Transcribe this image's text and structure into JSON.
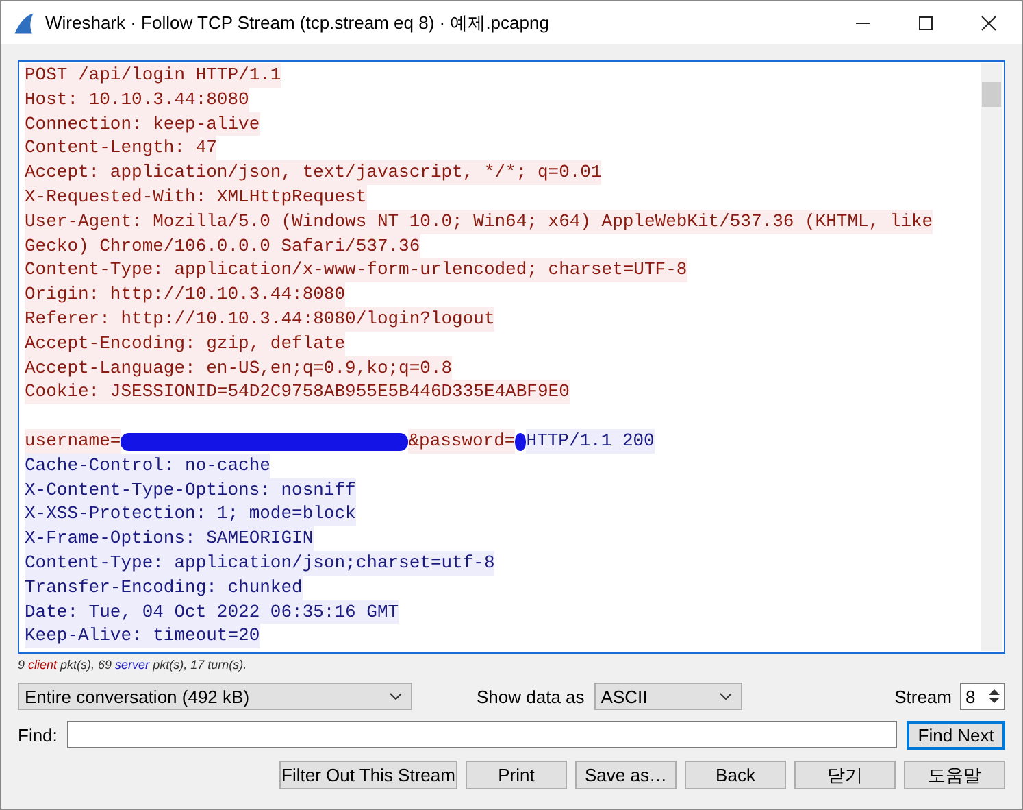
{
  "window": {
    "title": "Wireshark · Follow TCP Stream (tcp.stream eq 8) · 예제.pcapng"
  },
  "stream_lines": [
    {
      "kind": "client",
      "text": "POST /api/login HTTP/1.1"
    },
    {
      "kind": "client",
      "text": "Host: 10.10.3.44:8080"
    },
    {
      "kind": "client",
      "text": "Connection: keep-alive"
    },
    {
      "kind": "client",
      "text": "Content-Length: 47"
    },
    {
      "kind": "client",
      "text": "Accept: application/json, text/javascript, */*; q=0.01"
    },
    {
      "kind": "client",
      "text": "X-Requested-With: XMLHttpRequest"
    },
    {
      "kind": "client",
      "text": "User-Agent: Mozilla/5.0 (Windows NT 10.0; Win64; x64) AppleWebKit/537.36 (KHTML, like"
    },
    {
      "kind": "client",
      "text": "Gecko) Chrome/106.0.0.0 Safari/537.36"
    },
    {
      "kind": "client",
      "text": "Content-Type: application/x-www-form-urlencoded; charset=UTF-8"
    },
    {
      "kind": "client",
      "text": "Origin: http://10.10.3.44:8080"
    },
    {
      "kind": "client",
      "text": "Referer: http://10.10.3.44:8080/login?logout"
    },
    {
      "kind": "client",
      "text": "Accept-Encoding: gzip, deflate"
    },
    {
      "kind": "client",
      "text": "Accept-Language: en-US,en;q=0.9,ko;q=0.8"
    },
    {
      "kind": "client",
      "text": "Cookie: JSESSIONID=54D2C9758AB955E5B446D335E4ABF9E0"
    },
    {
      "kind": "blank"
    },
    {
      "kind": "mixed",
      "parts": [
        {
          "kind": "client",
          "text": "username="
        },
        {
          "kind": "redacted"
        },
        {
          "kind": "client",
          "text": "&password="
        },
        {
          "kind": "redacted"
        },
        {
          "kind": "server",
          "text": "HTTP/1.1 200"
        }
      ]
    },
    {
      "kind": "server",
      "text": "Cache-Control: no-cache"
    },
    {
      "kind": "server",
      "text": "X-Content-Type-Options: nosniff"
    },
    {
      "kind": "server",
      "text": "X-XSS-Protection: 1; mode=block"
    },
    {
      "kind": "server",
      "text": "X-Frame-Options: SAMEORIGIN"
    },
    {
      "kind": "server",
      "text": "Content-Type: application/json;charset=utf-8"
    },
    {
      "kind": "server",
      "text": "Transfer-Encoding: chunked"
    },
    {
      "kind": "server",
      "text": "Date: Tue, 04 Oct 2022 06:35:16 GMT"
    },
    {
      "kind": "server",
      "text": "Keep-Alive: timeout=20"
    }
  ],
  "stats": [
    {
      "kind": "plain",
      "text": "9 "
    },
    {
      "kind": "client",
      "text": "client"
    },
    {
      "kind": "plain",
      "text": " pkt(s), 69 "
    },
    {
      "kind": "server",
      "text": "server"
    },
    {
      "kind": "plain",
      "text": " pkt(s), 17 turn(s)."
    }
  ],
  "conversation_select": {
    "value": "Entire conversation (492 kB)"
  },
  "show_data_as": {
    "label": "Show data as",
    "value": "ASCII"
  },
  "stream": {
    "label": "Stream",
    "value": "8"
  },
  "find": {
    "label": "Find:",
    "button": "Find Next"
  },
  "buttons": [
    "Filter Out This Stream",
    "Print",
    "Save as…",
    "Back",
    "닫기",
    "도움말"
  ]
}
